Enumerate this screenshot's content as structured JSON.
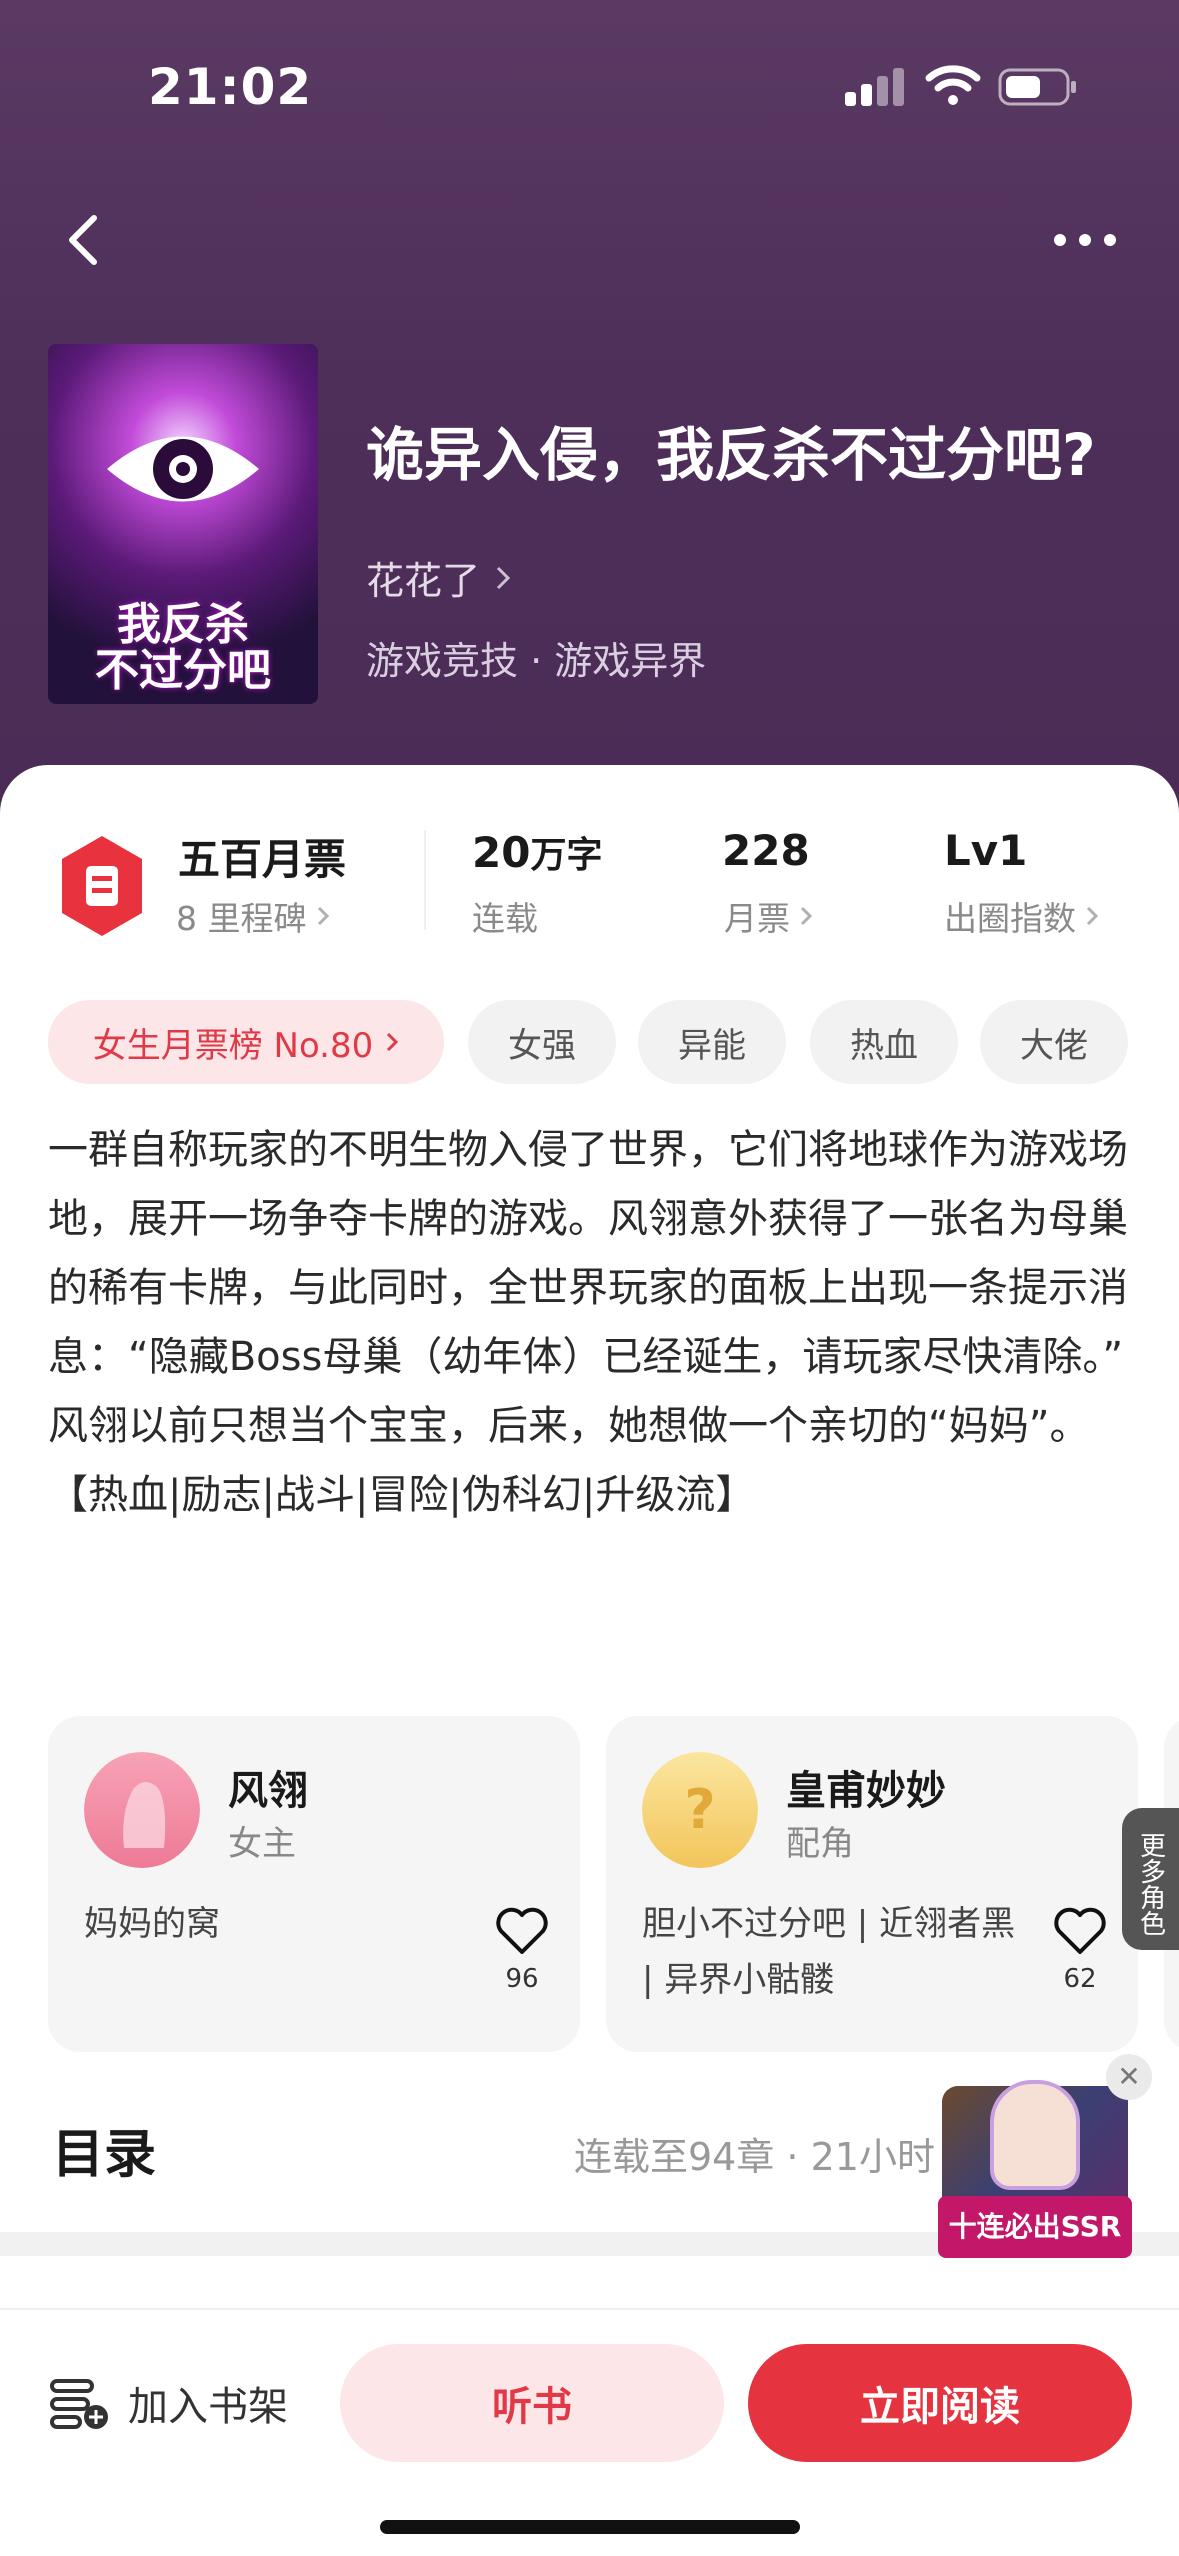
{
  "status_bar": {
    "time": "21:02"
  },
  "header": {
    "book_title": "诡异入侵，我反杀不过分吧?",
    "author": "花花了",
    "genre": "游戏竞技 · 游戏异界",
    "cover_title_line1": "我反杀",
    "cover_title_line2": "不过分吧"
  },
  "stats": {
    "rank_title": "五百月票",
    "rank_sub": "8 里程碑",
    "words_value": "20",
    "words_unit": "万字",
    "words_sub": "连载",
    "tickets_value": "228",
    "tickets_sub": "月票",
    "level_value": "Lv1",
    "level_sub": "出圈指数"
  },
  "tags": {
    "hot_tag": "女生月票榜 No.80",
    "items": [
      "女强",
      "异能",
      "热血",
      "大佬"
    ]
  },
  "description": {
    "paragraph1": "一群自称玩家的不明生物入侵了世界，它们将地球作为游戏场地，展开一场争夺卡牌的游戏。风翎意外获得了一张名为母巢的稀有卡牌，与此同时，全世界玩家的面板上出现一条提示消息：“隐藏Boss母巢（幼年体）已经诞生，请玩家尽快清除。”",
    "paragraph2": "风翎以前只想当个宝宝，后来，她想做一个亲切的“妈妈”。",
    "paragraph3": "【热血|励志|战斗|冒险|伪科幻|升级流】"
  },
  "roles": [
    {
      "name": "风翎",
      "type": "女主",
      "desc": "妈妈的窝",
      "likes": "96"
    },
    {
      "name": "皇甫妙妙",
      "type": "配角",
      "desc": "胆小不过分吧 | 近翎者黑 | 异界小骷髅",
      "likes": "62"
    }
  ],
  "more_roles_label": "更多角色",
  "toc": {
    "title": "目录",
    "info": "连载至94章 · 21小时"
  },
  "promo": {
    "label": "十连必出SSR"
  },
  "bottom": {
    "shelf_label": "加入书架",
    "listen_label": "听书",
    "read_label": "立即阅读"
  },
  "colors": {
    "accent_red": "#e5333f",
    "hero_purple": "#4e2f5a",
    "hot_tag_bg": "#fde6e7"
  }
}
